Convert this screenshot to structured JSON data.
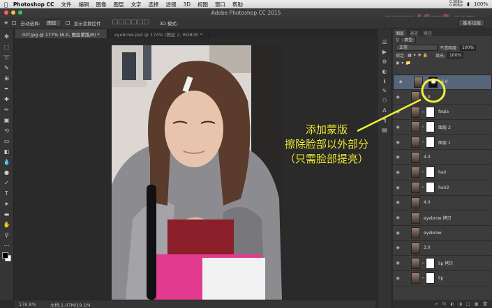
{
  "menubar": {
    "app_name": "Photoshop CC",
    "items": [
      "文件",
      "编辑",
      "图像",
      "图层",
      "文字",
      "选择",
      "滤镜",
      "3D",
      "视图",
      "窗口",
      "帮助"
    ],
    "net_up": "0.3KB/s",
    "net_down": "0.8KB/s",
    "battery": "100%"
  },
  "titlebar": {
    "title": "Adobe Photoshop CC 2015",
    "watermark": "www.16xx8.com"
  },
  "options": {
    "auto_select_label": "自动选择:",
    "auto_select_value": "图层",
    "show_transform_label": "显示变换控件",
    "mode_3d": "3D 模式:",
    "workspace": "基本功能"
  },
  "tabs": [
    {
      "label": "02f.jpg @ 177% (6.0, 图层蒙版/8) *",
      "active": true
    },
    {
      "label": "eyebrow.psd @ 174% (图层 2, RGB/8) *",
      "active": false
    }
  ],
  "status": {
    "zoom": "176.8%",
    "doc": "文档:1.07M/19.1M"
  },
  "panel": {
    "tabs": [
      "图层",
      "通道",
      "路径"
    ],
    "kind_label": "类型",
    "blend_mode": "正常",
    "opacity_label": "不透明度:",
    "opacity_value": "100%",
    "lock_label": "锁定:",
    "fill_label": "填充:",
    "fill_value": "100%",
    "layers": [
      {
        "name": "6.0",
        "selected": true,
        "mask": "dark"
      },
      {
        "name": "5.0",
        "selected": false,
        "mask": "none"
      },
      {
        "name": "faqia",
        "selected": false,
        "mask": "white"
      },
      {
        "name": "图层 2",
        "selected": false,
        "mask": "white"
      },
      {
        "name": "图层 1",
        "selected": false,
        "mask": "white"
      },
      {
        "name": "4.0",
        "selected": false,
        "mask": "none"
      },
      {
        "name": "hair",
        "selected": false,
        "mask": "white"
      },
      {
        "name": "hair2",
        "selected": false,
        "mask": "white"
      },
      {
        "name": "4.0",
        "selected": false,
        "mask": "none"
      },
      {
        "name": "eyebrow 拷贝",
        "selected": false,
        "mask": "none"
      },
      {
        "name": "eyebrow",
        "selected": false,
        "mask": "none"
      },
      {
        "name": "3.0",
        "selected": false,
        "mask": "none"
      },
      {
        "name": "lip 拷贝",
        "selected": false,
        "mask": "white"
      },
      {
        "name": "lip",
        "selected": false,
        "mask": "white"
      }
    ]
  },
  "callout": {
    "line1": "添加蒙版",
    "line2": "擦除脸部以外部分",
    "line3": "（只需脸部提亮）",
    "color": "#f4ef3a"
  }
}
